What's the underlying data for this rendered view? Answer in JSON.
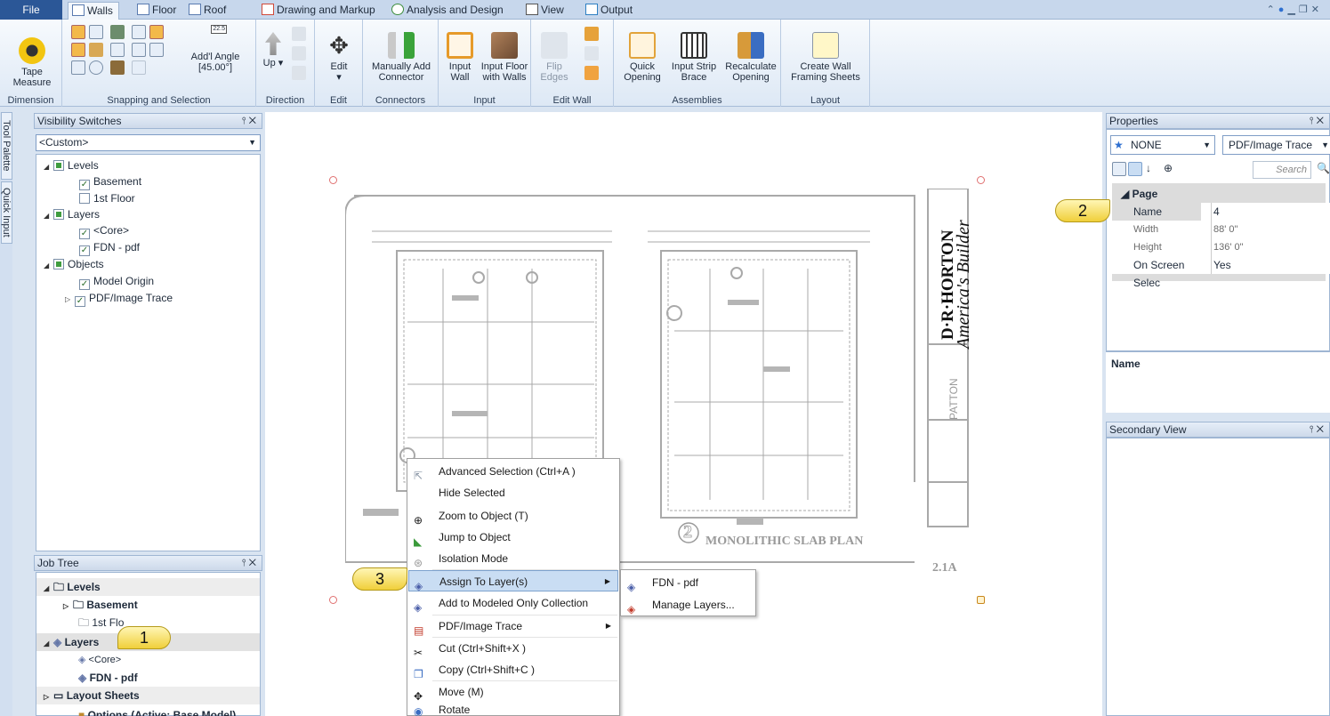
{
  "ribbon_tabs": [
    {
      "label": "File"
    },
    {
      "label": "Walls"
    },
    {
      "label": "Floor"
    },
    {
      "label": "Roof"
    },
    {
      "label": "Drawing and Markup"
    },
    {
      "label": "Analysis and Design"
    },
    {
      "label": "View"
    },
    {
      "label": "Output"
    }
  ],
  "ribbon": {
    "dimension": {
      "group": "Dimension",
      "tape_measure": "Tape\nMeasure"
    },
    "snapping": {
      "group": "Snapping and Selection",
      "addl_angle": "Add'l Angle",
      "angle_value": "[45.00°]",
      "angle_box": "22.5"
    },
    "direction": {
      "group": "Direction",
      "up": "Up"
    },
    "edit": {
      "group": "Edit",
      "edit": "Edit"
    },
    "connectors": {
      "group": "Connectors",
      "manually_add": "Manually Add\nConnector"
    },
    "input": {
      "group": "Input",
      "input_wall": "Input\nWall",
      "input_floor": "Input Floor\nwith Walls"
    },
    "edit_wall": {
      "group": "Edit Wall",
      "flip_edges": "Flip\nEdges"
    },
    "assemblies": {
      "group": "Assemblies",
      "quick_opening": "Quick\nOpening",
      "input_strip_brace": "Input Strip\nBrace",
      "recalculate": "Recalculate\nOpening"
    },
    "layout": {
      "group": "Layout",
      "create_wall_framing": "Create Wall\nFraming Sheets"
    }
  },
  "side_tabs": {
    "tool_palette": "Tool Palette",
    "quick_input": "Quick Input"
  },
  "visibility": {
    "title": "Visibility Switches",
    "preset": "<Custom>",
    "tree": [
      {
        "label": "Levels"
      },
      {
        "label": "Basement"
      },
      {
        "label": "1st Floor"
      },
      {
        "label": "Layers"
      },
      {
        "label": "<Core>"
      },
      {
        "label": "FDN - pdf"
      },
      {
        "label": "Objects"
      },
      {
        "label": "Model Origin"
      },
      {
        "label": "PDF/Image Trace"
      }
    ]
  },
  "job_tree": {
    "title": "Job Tree",
    "rows": [
      {
        "label": "Levels"
      },
      {
        "label": "Basement"
      },
      {
        "label": "1st Flo"
      },
      {
        "label": "Layers"
      },
      {
        "label": "<Core>"
      },
      {
        "label": "FDN - pdf"
      },
      {
        "label": "Layout Sheets"
      },
      {
        "label": "Options (Active: Base Model)"
      }
    ]
  },
  "drawing": {
    "brand": "D·R·HORTON",
    "tagline": "America's Builder",
    "plan_title": "MONOLITHIC SLAB PLAN",
    "sheet_number": "2.1A",
    "side_label": "PATTON",
    "detail_number": "2"
  },
  "context_menu": [
    {
      "label": "Advanced Selection (Ctrl+A )"
    },
    {
      "label": "Hide Selected"
    },
    {
      "label": "Zoom to Object (T)"
    },
    {
      "label": "Jump to Object"
    },
    {
      "label": "Isolation Mode"
    },
    {
      "label": "Assign To Layer(s)"
    },
    {
      "label": "Add to Modeled Only Collection"
    },
    {
      "label": "PDF/Image Trace"
    },
    {
      "label": "Cut (Ctrl+Shift+X )"
    },
    {
      "label": "Copy (Ctrl+Shift+C )"
    },
    {
      "label": "Move (M)"
    },
    {
      "label": "Rotate"
    }
  ],
  "submenu": [
    {
      "label": "FDN - pdf"
    },
    {
      "label": "Manage Layers..."
    }
  ],
  "properties": {
    "title": "Properties",
    "type_value": "NONE",
    "filter_value": "PDF/Image Trace",
    "search_placeholder": "Search",
    "category": "Page",
    "rows": [
      {
        "key": "Name",
        "value": "4"
      },
      {
        "key": "Width",
        "value": "88' 0\""
      },
      {
        "key": "Height",
        "value": "136' 0\""
      },
      {
        "key": "On Screen Selec",
        "value": "Yes"
      }
    ],
    "desc_title": "Name"
  },
  "secondary_view": {
    "title": "Secondary View"
  },
  "callouts": {
    "c1": "1",
    "c2": "2",
    "c3": "3"
  },
  "colors": {
    "accent": "#2b5797",
    "highlight": "#c9ddf3",
    "callout": "#f0cf3a"
  }
}
